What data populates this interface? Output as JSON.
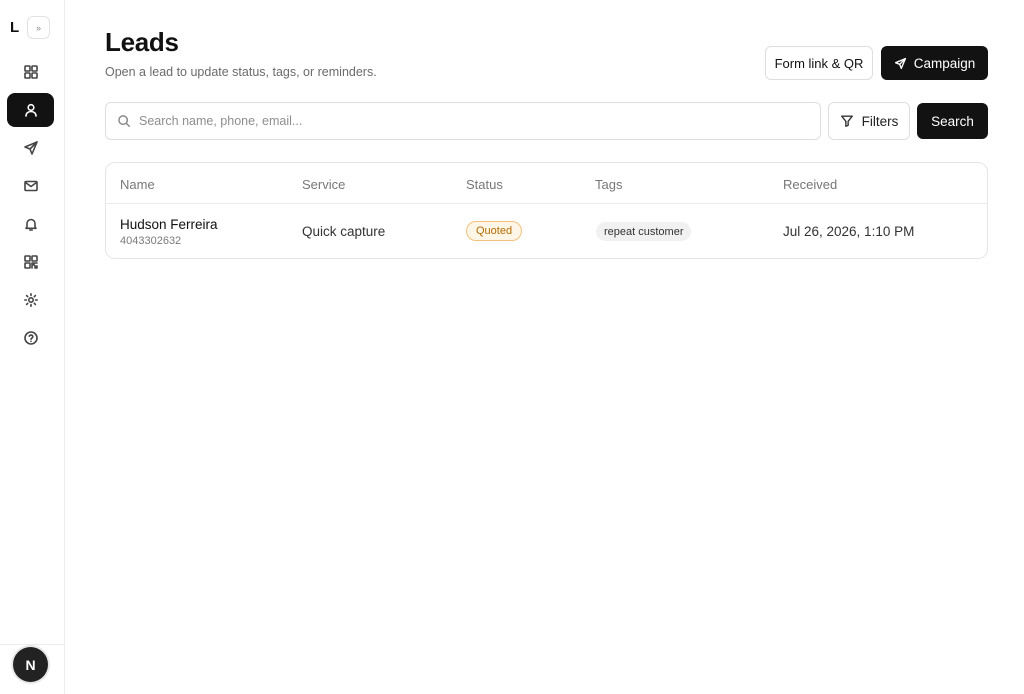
{
  "sidebar": {
    "brand": "L",
    "collapse_glyph": "»",
    "items": [
      {
        "icon": "dashboard-grid-icon",
        "active": false
      },
      {
        "icon": "user-icon",
        "active": true
      },
      {
        "icon": "send-icon",
        "active": false
      },
      {
        "icon": "mail-icon",
        "active": false
      },
      {
        "icon": "bell-icon",
        "active": false
      },
      {
        "icon": "qr-code-icon",
        "active": false
      },
      {
        "icon": "gear-icon",
        "active": false
      },
      {
        "icon": "help-circle-icon",
        "active": false
      }
    ],
    "avatar_initial": "N"
  },
  "header": {
    "title": "Leads",
    "subtitle": "Open a lead to update status, tags, or reminders.",
    "form_link_label": "Form link & QR",
    "campaign_label": "Campaign"
  },
  "search": {
    "placeholder": "Search name, phone, email...",
    "value": "",
    "filters_label": "Filters",
    "search_label": "Search"
  },
  "table": {
    "columns": [
      "Name",
      "Service",
      "Status",
      "Tags",
      "Received"
    ],
    "rows": [
      {
        "name": "Hudson Ferreira",
        "phone": "4043302632",
        "service": "Quick capture",
        "status": "Quoted",
        "tags": [
          "repeat customer"
        ],
        "received": "Jul 26, 2026, 1:10 PM"
      }
    ]
  },
  "colors": {
    "primary_dark": "#121212",
    "status_quoted_bg": "#fff6e8",
    "status_quoted_text": "#b26a00",
    "status_quoted_border": "#f0c27a"
  }
}
